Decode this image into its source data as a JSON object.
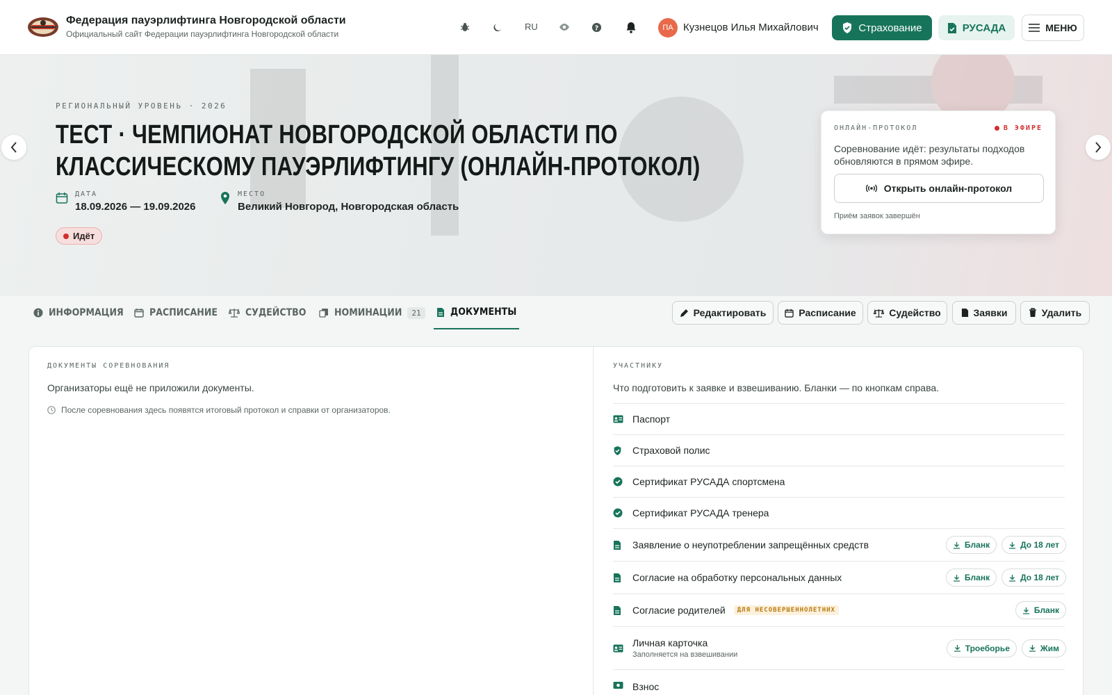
{
  "header": {
    "site_title": "Федерация пауэрлифтинга Новгородской области",
    "site_subtitle": "Официальный сайт Федерации пауэрлифтинга Новгородской области",
    "lang": "RU",
    "user_initials": "ПА",
    "user_name": "Кузнецов Илья Михайлович",
    "insurance_label": "Страхование",
    "rusada_label": "РУСАДА",
    "menu_label": "МЕНЮ"
  },
  "hero": {
    "eyebrow": "РЕГИОНАЛЬНЫЙ УРОВЕНЬ · 2026",
    "title": "ТЕСТ · ЧЕМПИОНАТ НОВГОРОДСКОЙ ОБЛАСТИ ПО КЛАССИЧЕСКОМУ ПАУЭРЛИФТИНГУ (ОНЛАЙН-ПРОТОКОЛ)",
    "date_label": "ДАТА",
    "date_value": "18.09.2026 — 19.09.2026",
    "place_label": "МЕСТО",
    "place_value": "Великий Новгород, Новгородская область",
    "status": "Идёт"
  },
  "live_card": {
    "label": "ОНЛАЙН-ПРОТОКОЛ",
    "on_air": "В ЭФИРЕ",
    "description": "Соревнование идёт: результаты подходов обновляются в прямом эфире.",
    "open_button": "Открыть онлайн-протокол",
    "closed_note": "Приём заявок завершён"
  },
  "tabs": [
    {
      "label": "ИНФОРМАЦИЯ"
    },
    {
      "label": "РАСПИСАНИЕ"
    },
    {
      "label": "СУДЕЙСТВО"
    },
    {
      "label": "НОМИНАЦИИ",
      "badge": "21"
    },
    {
      "label": "ДОКУМЕНТЫ"
    }
  ],
  "actions": {
    "edit": "Редактировать",
    "schedule": "Расписание",
    "judging": "Судейство",
    "entries": "Заявки",
    "delete": "Удалить"
  },
  "docs": {
    "label": "ДОКУМЕНТЫ СОРЕВНОВАНИЯ",
    "empty": "Организаторы ещё не приложили документы.",
    "note": "После соревнования здесь появятся итоговый протокол и справки от организаторов."
  },
  "participants": {
    "label": "УЧАСТНИКУ",
    "intro": "Что подготовить к заявке и взвешиванию. Бланки — по кнопкам справа.",
    "rows": [
      {
        "name": "Паспорт"
      },
      {
        "name": "Страховой полис"
      },
      {
        "name": "Сертификат РУСАДА спортсмена"
      },
      {
        "name": "Сертификат РУСАДА тренера"
      },
      {
        "name": "Заявление о неупотреблении запрещённых средств",
        "b1": "Бланк",
        "b2": "До 18 лет"
      },
      {
        "name": "Согласие на обработку персональных данных",
        "b1": "Бланк",
        "b2": "До 18 лет"
      },
      {
        "name": "Согласие родителей",
        "tag": "ДЛЯ НЕСОВЕРШЕННОЛЕТНИХ",
        "b1": "Бланк"
      },
      {
        "name": "Личная карточка",
        "sub": "Заполняется на взвешивании",
        "b1": "Троеборье",
        "b2": "Жим"
      },
      {
        "name": "Взнос"
      }
    ]
  }
}
